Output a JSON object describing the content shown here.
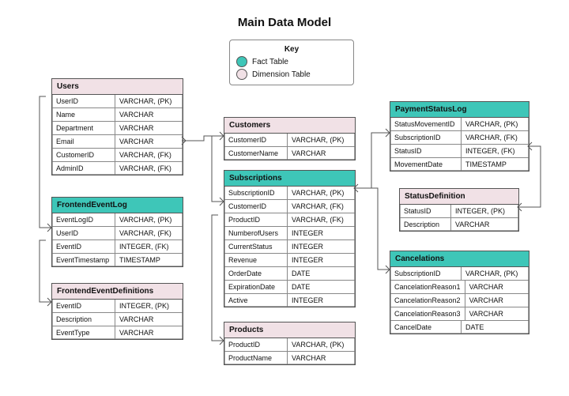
{
  "title": "Main Data Model",
  "legend": {
    "title": "Key",
    "fact": "Fact Table",
    "dim": "Dimension Table"
  },
  "entities": {
    "users": {
      "name": "Users",
      "columns": [
        {
          "name": "UserID",
          "type": "VARCHAR, (PK)"
        },
        {
          "name": "Name",
          "type": "VARCHAR"
        },
        {
          "name": "Department",
          "type": "VARCHAR"
        },
        {
          "name": "Email",
          "type": "VARCHAR"
        },
        {
          "name": "CustomerID",
          "type": "VARCHAR, (FK)"
        },
        {
          "name": "AdminID",
          "type": "VARCHAR, (FK)"
        }
      ]
    },
    "frontendEventLog": {
      "name": "FrontendEventLog",
      "columns": [
        {
          "name": "EventLogID",
          "type": "VARCHAR, (PK)"
        },
        {
          "name": "UserID",
          "type": "VARCHAR, (FK)"
        },
        {
          "name": "EventID",
          "type": "INTEGER, (FK)"
        },
        {
          "name": "EventTimestamp",
          "type": "TIMESTAMP"
        }
      ]
    },
    "frontendEventDefinitions": {
      "name": "FrontendEventDefinitions",
      "columns": [
        {
          "name": "EventID",
          "type": "INTEGER, (PK)"
        },
        {
          "name": "Description",
          "type": "VARCHAR"
        },
        {
          "name": "EventType",
          "type": "VARCHAR"
        }
      ]
    },
    "customers": {
      "name": "Customers",
      "columns": [
        {
          "name": "CustomerID",
          "type": "VARCHAR, (PK)"
        },
        {
          "name": "CustomerName",
          "type": "VARCHAR"
        }
      ]
    },
    "subscriptions": {
      "name": "Subscriptions",
      "columns": [
        {
          "name": "SubscriptionID",
          "type": "VARCHAR, (PK)"
        },
        {
          "name": "CustomerID",
          "type": "VARCHAR, (FK)"
        },
        {
          "name": "ProductID",
          "type": "VARCHAR, (FK)"
        },
        {
          "name": "NumberofUsers",
          "type": "INTEGER"
        },
        {
          "name": "CurrentStatus",
          "type": "INTEGER"
        },
        {
          "name": "Revenue",
          "type": "INTEGER"
        },
        {
          "name": "OrderDate",
          "type": "DATE"
        },
        {
          "name": "ExpirationDate",
          "type": "DATE"
        },
        {
          "name": "Active",
          "type": "INTEGER"
        }
      ]
    },
    "products": {
      "name": "Products",
      "columns": [
        {
          "name": "ProductID",
          "type": "VARCHAR, (PK)"
        },
        {
          "name": "ProductName",
          "type": "VARCHAR"
        }
      ]
    },
    "paymentStatusLog": {
      "name": "PaymentStatusLog",
      "columns": [
        {
          "name": "StatusMovementID",
          "type": "VARCHAR, (PK)"
        },
        {
          "name": "SubscriptionID",
          "type": "VARCHAR, (FK)"
        },
        {
          "name": "StatusID",
          "type": "INTEGER, (FK)"
        },
        {
          "name": "MovementDate",
          "type": "TIMESTAMP"
        }
      ]
    },
    "statusDefinition": {
      "name": "StatusDefinition",
      "columns": [
        {
          "name": "StatusID",
          "type": "INTEGER, (PK)"
        },
        {
          "name": "Description",
          "type": "VARCHAR"
        }
      ]
    },
    "cancelations": {
      "name": "Cancelations",
      "columns": [
        {
          "name": "SubscriptionID",
          "type": "VARCHAR, (PK)"
        },
        {
          "name": "CancelationReason1",
          "type": "VARCHAR"
        },
        {
          "name": "CancelationReason2",
          "type": "VARCHAR"
        },
        {
          "name": "CancelationReason3",
          "type": "VARCHAR"
        },
        {
          "name": "CancelDate",
          "type": "DATE"
        }
      ]
    }
  }
}
